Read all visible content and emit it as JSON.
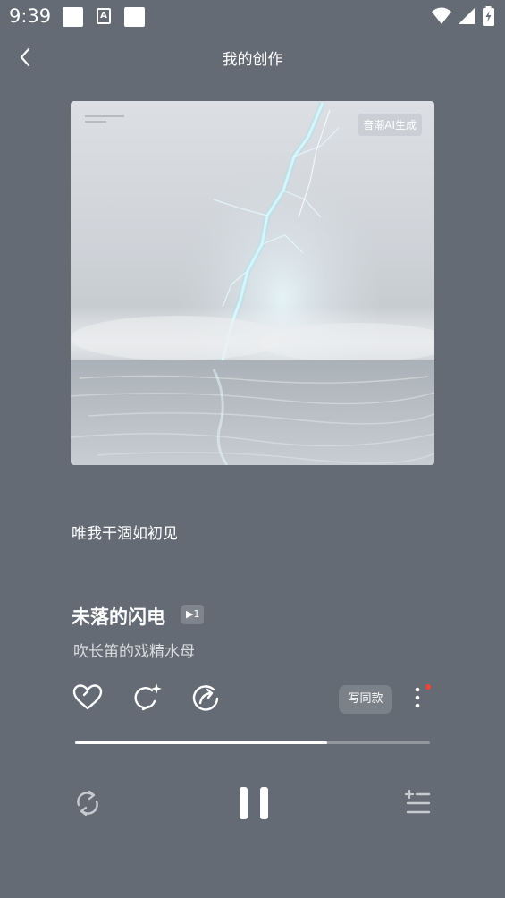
{
  "status_bar": {
    "time": "9:39",
    "notification_letter": "A",
    "icons": [
      "wifi-icon",
      "signal-icon",
      "battery-charging-icon"
    ]
  },
  "header": {
    "title": "我的创作",
    "back_icon": "chevron-left-icon"
  },
  "cover": {
    "badge": "音潮AI生成"
  },
  "lyric": "唯我干涸如初见",
  "song": {
    "title": "未落的闪电",
    "play_count": "▶1",
    "artist": "吹长笛的戏精水母"
  },
  "actions": {
    "like_icon": "heart-icon",
    "remix_icon": "sparkle-loop-icon",
    "share_icon": "share-icon",
    "write_same_label": "写同款",
    "more_icon": "more-vertical-icon",
    "has_notification": true
  },
  "player": {
    "progress": 0.71,
    "repeat_icon": "repeat-icon",
    "state": "playing",
    "pause_icon": "pause-icon",
    "playlist_icon": "playlist-icon"
  },
  "colors": {
    "background": "#646b74",
    "accent_red": "#f0433a"
  }
}
